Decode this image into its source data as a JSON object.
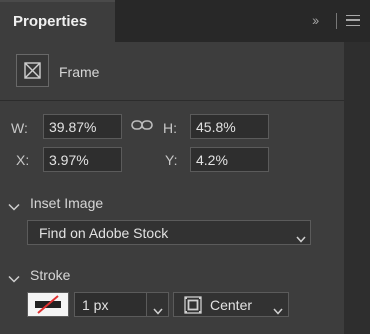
{
  "panel": {
    "tab_title": "Properties",
    "object_type": "Frame"
  },
  "transform": {
    "w_label": "W:",
    "w_value": "39.87%",
    "h_label": "H:",
    "h_value": "45.8%",
    "x_label": "X:",
    "x_value": "3.97%",
    "y_label": "Y:",
    "y_value": "4.2%"
  },
  "inset_image": {
    "title": "Inset Image",
    "option": "Find on Adobe Stock"
  },
  "stroke": {
    "title": "Stroke",
    "width": "1 px",
    "align": "Center",
    "swatch_color": "#f4f4f4",
    "swatch_slash_color": "#e03030"
  },
  "icons": {
    "collapse": "double-chevron-right-icon",
    "menu": "hamburger-menu-icon",
    "frame": "frame-placeholder-icon",
    "link": "chain-link-icon",
    "stroke_align": "stroke-center-align-icon"
  }
}
